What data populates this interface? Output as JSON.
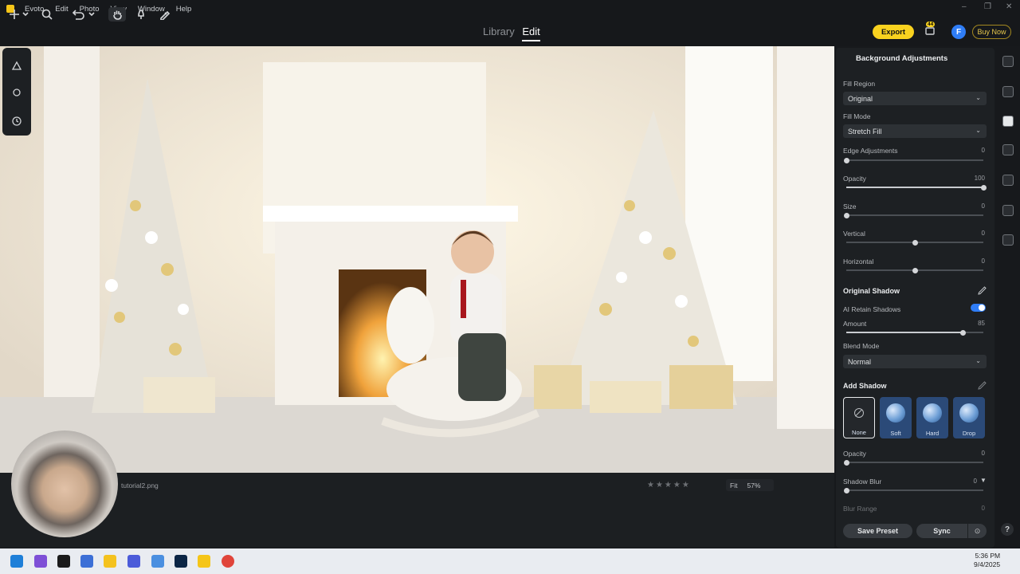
{
  "app": {
    "name": "Evoto"
  },
  "menu": [
    "Evoto",
    "Edit",
    "Photo",
    "View",
    "Window",
    "Help"
  ],
  "window_controls": [
    "–",
    "❐",
    "✕"
  ],
  "toolbar": {
    "tabs": {
      "library": "Library",
      "edit": "Edit"
    },
    "export_label": "Export",
    "notifications_count": "44",
    "avatar_letter": "F",
    "buy_now_label": "Buy Now"
  },
  "canvas": {
    "file_name": "tutorial2.png",
    "zoom": {
      "fit_label": "Fit",
      "percent": "57%"
    },
    "rating_stars": "★★★★★"
  },
  "panel": {
    "title": "Background Adjustments",
    "fill_region": {
      "label": "Fill Region",
      "value": "Original"
    },
    "fill_mode": {
      "label": "Fill Mode",
      "value": "Stretch Fill"
    },
    "sliders": [
      {
        "label": "Edge Adjustments",
        "value": "0",
        "level": 0
      },
      {
        "label": "Opacity",
        "value": "100",
        "level": 1
      },
      {
        "label": "Size",
        "value": "0",
        "level": 0
      },
      {
        "label": "Vertical",
        "value": "0",
        "level": 0.5
      },
      {
        "label": "Horizontal",
        "value": "0",
        "level": 0.5
      }
    ],
    "original_shadow": {
      "title": "Original Shadow",
      "ai_retain": {
        "label": "AI Retain Shadows",
        "on": true
      },
      "amount": {
        "label": "Amount",
        "value": "85",
        "level": 0.85
      },
      "blend_mode": {
        "label": "Blend Mode",
        "value": "Normal"
      }
    },
    "add_shadow": {
      "title": "Add Shadow",
      "options": [
        "None",
        "Soft",
        "Hard",
        "Drop"
      ],
      "selected": "None",
      "opacity": {
        "label": "Opacity",
        "value": "0",
        "level": 0
      },
      "shadow_blur": {
        "label": "Shadow Blur",
        "value": "0",
        "level": 0
      },
      "blur_range": {
        "label": "Blur Range",
        "value": "0"
      }
    },
    "save_preset_label": "Save Preset",
    "sync_label": "Sync"
  },
  "taskbar": {
    "time": "5:36 PM",
    "date": "9/4/2025"
  },
  "colors": {
    "accent": "#f9d21f",
    "toggle_blue": "#2f7df6"
  }
}
